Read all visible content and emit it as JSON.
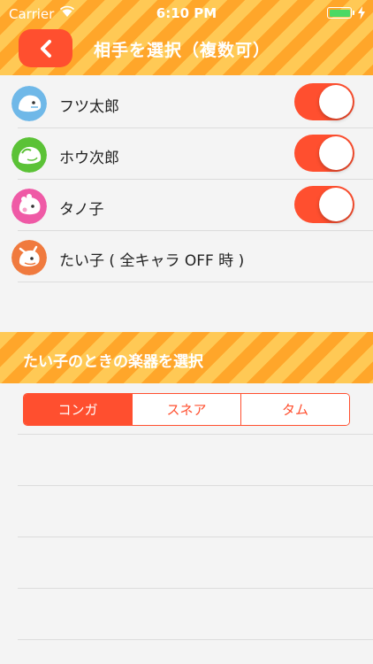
{
  "status_bar": {
    "carrier": "Carrier",
    "time": "6:10 PM"
  },
  "header": {
    "title": "相手を選択（複数可）"
  },
  "characters": [
    {
      "name": "フツ太郎",
      "toggle_on": true,
      "color": "#6fb8e8"
    },
    {
      "name": "ホウ次郎",
      "toggle_on": true,
      "color": "#5bc236"
    },
    {
      "name": "タノ子",
      "toggle_on": true,
      "color": "#ef5aa6"
    },
    {
      "name": "たい子 ( 全キャラ OFF 時 )",
      "toggle_on": null,
      "color": "#f07a3e"
    }
  ],
  "instrument_section": {
    "title": "たい子のときの楽器を選択",
    "options": [
      "コンガ",
      "スネア",
      "タム"
    ],
    "selected": "コンガ"
  },
  "colors": {
    "accent": "#ff4f2f",
    "header_orange": "#ffa62a"
  }
}
